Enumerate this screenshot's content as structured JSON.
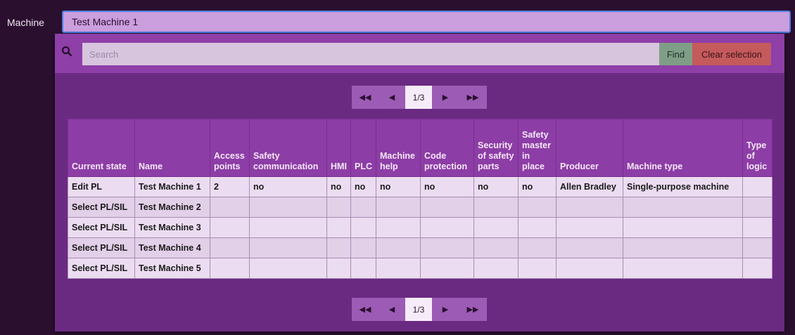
{
  "machine_field": {
    "label": "Machine",
    "value": "Test Machine 1"
  },
  "search": {
    "placeholder": "Search",
    "find_label": "Find",
    "clear_label": "Clear selection"
  },
  "pagination": {
    "current": "1/3",
    "first_icon": "first-page-icon",
    "prev_icon": "prev-page-icon",
    "next_icon": "next-page-icon",
    "last_icon": "last-page-icon"
  },
  "table": {
    "columns": [
      "Current state",
      "Name",
      "Access points",
      "Safety communication",
      "HMI",
      "PLC",
      "Machine help",
      "Code protection",
      "Security of safety parts",
      "Safety master in place",
      "Producer",
      "Machine type",
      "Type of logic"
    ],
    "rows": [
      [
        "Edit PL",
        "Test Machine 1",
        "2",
        "no",
        "no",
        "no",
        "no",
        "no",
        "no",
        "no",
        "Allen Bradley",
        "Single-purpose machine",
        ""
      ],
      [
        "Select PL/SIL",
        "Test Machine 2",
        "",
        "",
        "",
        "",
        "",
        "",
        "",
        "",
        "",
        "",
        ""
      ],
      [
        "Select PL/SIL",
        "Test Machine 3",
        "",
        "",
        "",
        "",
        "",
        "",
        "",
        "",
        "",
        "",
        ""
      ],
      [
        "Select PL/SIL",
        "Test Machine 4",
        "",
        "",
        "",
        "",
        "",
        "",
        "",
        "",
        "",
        "",
        ""
      ],
      [
        "Select PL/SIL",
        "Test Machine 5",
        "",
        "",
        "",
        "",
        "",
        "",
        "",
        "",
        "",
        "",
        ""
      ]
    ]
  },
  "colors": {
    "background": "#2a0f2e",
    "panel": "#6b2a82",
    "header": "#8d3da6",
    "find": "#7f9e87",
    "clear": "#c45a5c",
    "focus_border": "#4c7ee0"
  }
}
